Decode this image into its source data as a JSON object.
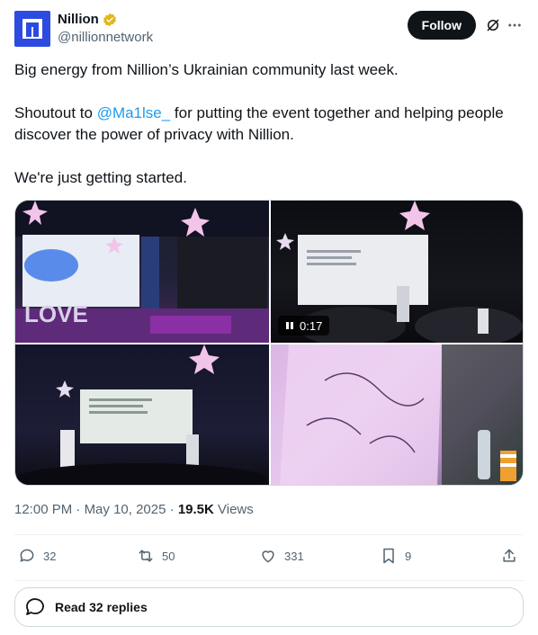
{
  "author": {
    "name": "Nillion",
    "handle": "@nillionnetwork",
    "verified_color": "#e2b719",
    "avatar_color": "#2d4be0"
  },
  "header": {
    "follow_label": "Follow"
  },
  "tweet": {
    "line1": "Big energy from Nillion’s Ukrainian community last week.",
    "line2_prefix": "Shoutout to ",
    "mention": "@Ma1lse_",
    "line2_suffix": " for putting the event together and helping people discover the power of privacy with Nillion.",
    "line3": "We're just getting started."
  },
  "media": {
    "video_duration": "0:17",
    "items": [
      {
        "icon": "photo-event-stage"
      },
      {
        "icon": "video-presentation"
      },
      {
        "icon": "photo-speakers"
      },
      {
        "icon": "photo-signed-shirt"
      }
    ]
  },
  "meta": {
    "time": "12:00 PM",
    "date": "May 10, 2025",
    "views_count": "19.5K",
    "views_label": "Views"
  },
  "actions": {
    "replies": "32",
    "reposts": "50",
    "likes": "331",
    "bookmarks": "9"
  },
  "read_replies_label": "Read 32 replies",
  "colors": {
    "accent": "#1d9bf0",
    "text": "#0f1419",
    "muted": "#536471"
  }
}
